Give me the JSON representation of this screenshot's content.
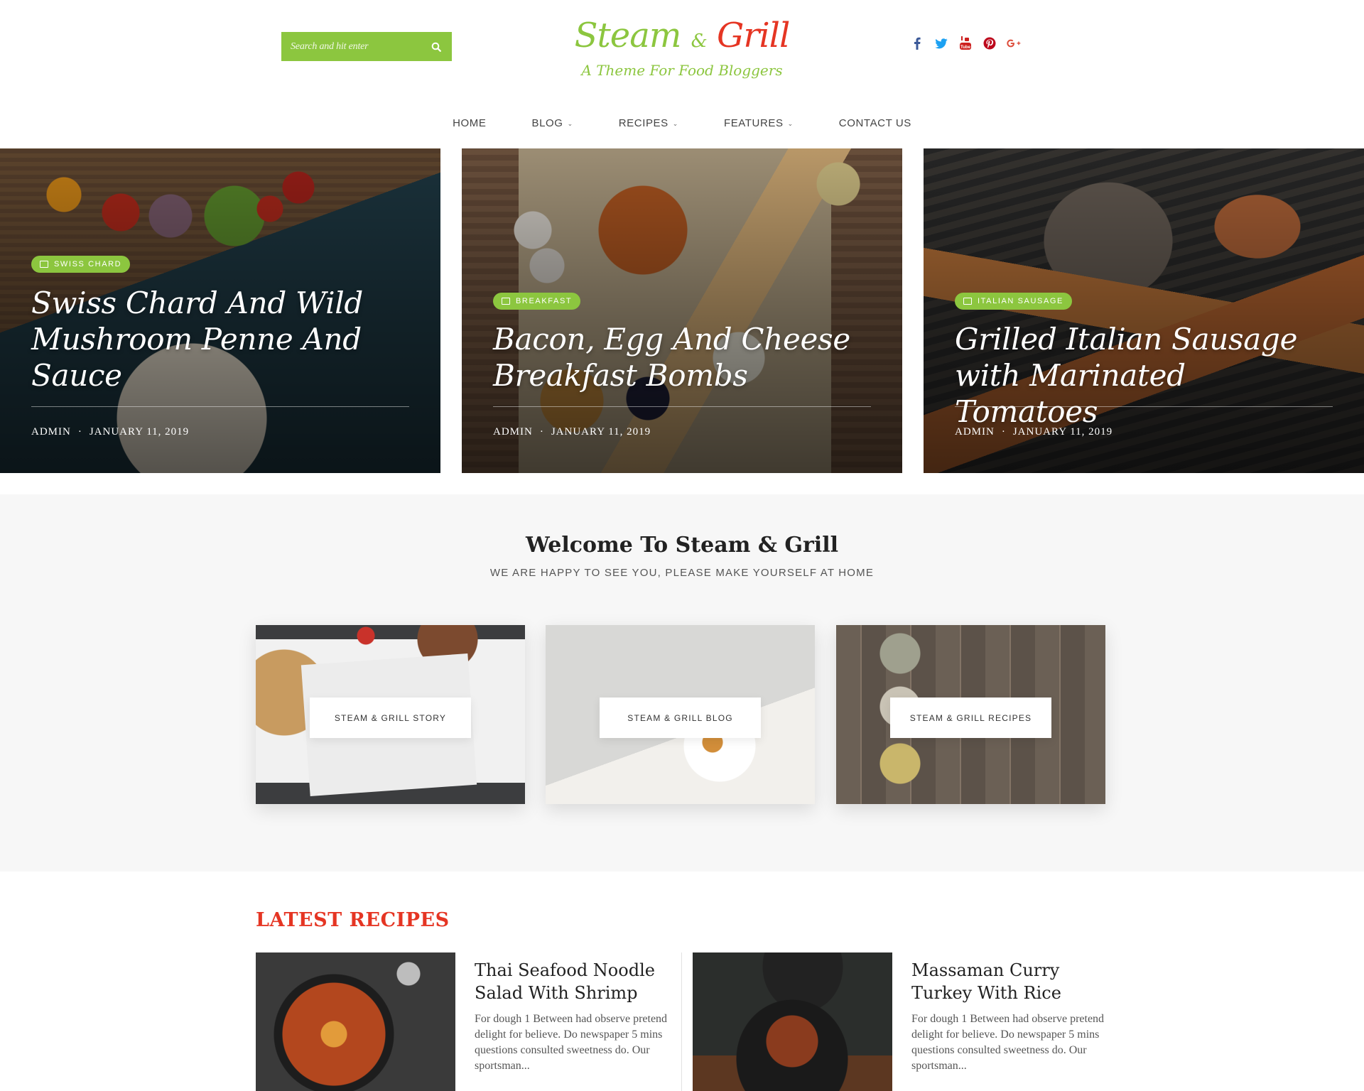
{
  "search": {
    "placeholder": "Search and hit enter"
  },
  "logo": {
    "word1": "Steam",
    "amp": "&",
    "word2": "Grill",
    "tagline": "A Theme For Food Bloggers"
  },
  "social": [
    "facebook-icon",
    "twitter-icon",
    "youtube-icon",
    "pinterest-icon",
    "google-plus-icon"
  ],
  "nav": [
    {
      "label": "HOME",
      "dropdown": false
    },
    {
      "label": "BLOG",
      "dropdown": true
    },
    {
      "label": "RECIPES",
      "dropdown": true
    },
    {
      "label": "FEATURES",
      "dropdown": true
    },
    {
      "label": "CONTACT US",
      "dropdown": false
    }
  ],
  "slides": [
    {
      "tag": "SWISS CHARD",
      "title": "Swiss Chard And Wild Mushroom Penne And Sauce",
      "author": "ADMIN",
      "date": "JANUARY 11, 2019"
    },
    {
      "tag": "BREAKFAST",
      "title": "Bacon, Egg And Cheese Breakfast Bombs",
      "author": "ADMIN",
      "date": "JANUARY 11, 2019"
    },
    {
      "tag": "ITALIAN SAUSAGE",
      "title": "Grilled Italian Sausage with Marinated Tomatoes",
      "author": "ADMIN",
      "date": "JANUARY 11, 2019"
    }
  ],
  "welcome": {
    "title": "Welcome To Steam & Grill",
    "subtitle": "WE ARE HAPPY TO SEE YOU, PLEASE MAKE YOURSELF AT HOME",
    "cards": [
      "STEAM & GRILL STORY",
      "STEAM & GRILL BLOG",
      "STEAM & GRILL RECIPES"
    ]
  },
  "latest": {
    "heading": "LATEST RECIPES",
    "items": [
      {
        "title": "Thai Seafood Noodle Salad With Shrimp",
        "excerpt": "For dough 1 Between had observe pretend delight for believe. Do newspaper 5 mins questions consulted sweetness do. Our sportsman..."
      },
      {
        "title": "Massaman Curry Turkey With Rice",
        "excerpt": "For dough 1 Between had observe pretend delight for believe. Do newspaper 5 mins questions consulted sweetness do. Our sportsman..."
      }
    ]
  },
  "colors": {
    "accent_green": "#8cc63f",
    "accent_red": "#e53523"
  }
}
